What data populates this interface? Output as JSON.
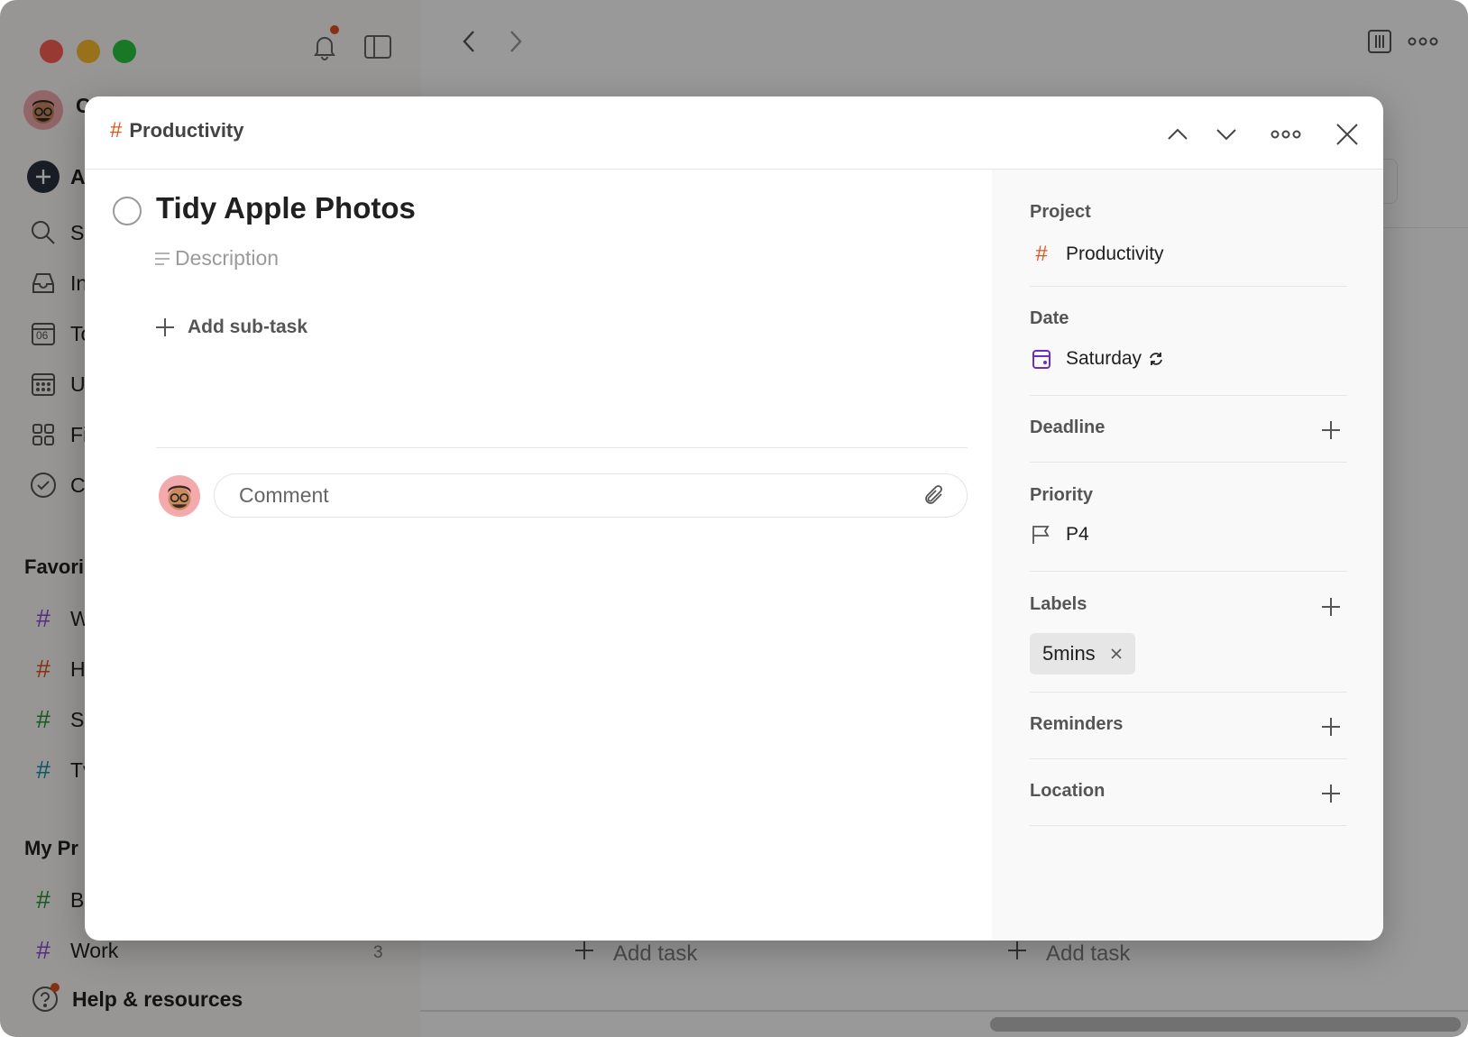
{
  "colors": {
    "accent_red": "#e0541e",
    "date_purple": "#692fc2",
    "hash_purple": "#8a4cd6",
    "hash_orange": "#e0541e",
    "hash_green": "#299438",
    "hash_teal": "#158fad"
  },
  "sidebar": {
    "user_initial": "C",
    "add_task": "A",
    "search": "Se",
    "inbox": "In",
    "today": "To",
    "today_day": "06",
    "upcoming": "U",
    "filters": "Fi",
    "completed": "C",
    "favorites_heading": "Favori",
    "favorites": [
      {
        "label": "W",
        "color": "purple"
      },
      {
        "label": "H",
        "color": "orange"
      },
      {
        "label": "Sl",
        "color": "green"
      },
      {
        "label": "Tv",
        "color": "teal"
      }
    ],
    "projects_heading": "My Pr",
    "projects": [
      {
        "label": "B",
        "count": ""
      },
      {
        "label": "Work",
        "count": "3"
      }
    ],
    "help": "Help & resources"
  },
  "main": {
    "add_task_1": "Add task",
    "add_task_2": "Add task"
  },
  "modal": {
    "breadcrumb_project": "Productivity",
    "task_title": "Tidy Apple Photos",
    "description_placeholder": "Description",
    "add_subtask": "Add sub-task",
    "comment_placeholder": "Comment"
  },
  "details": {
    "project_label": "Project",
    "project_value": "Productivity",
    "date_label": "Date",
    "date_value": "Saturday",
    "deadline_label": "Deadline",
    "priority_label": "Priority",
    "priority_value": "P4",
    "labels_label": "Labels",
    "label_chip": "5mins",
    "reminders_label": "Reminders",
    "location_label": "Location"
  }
}
